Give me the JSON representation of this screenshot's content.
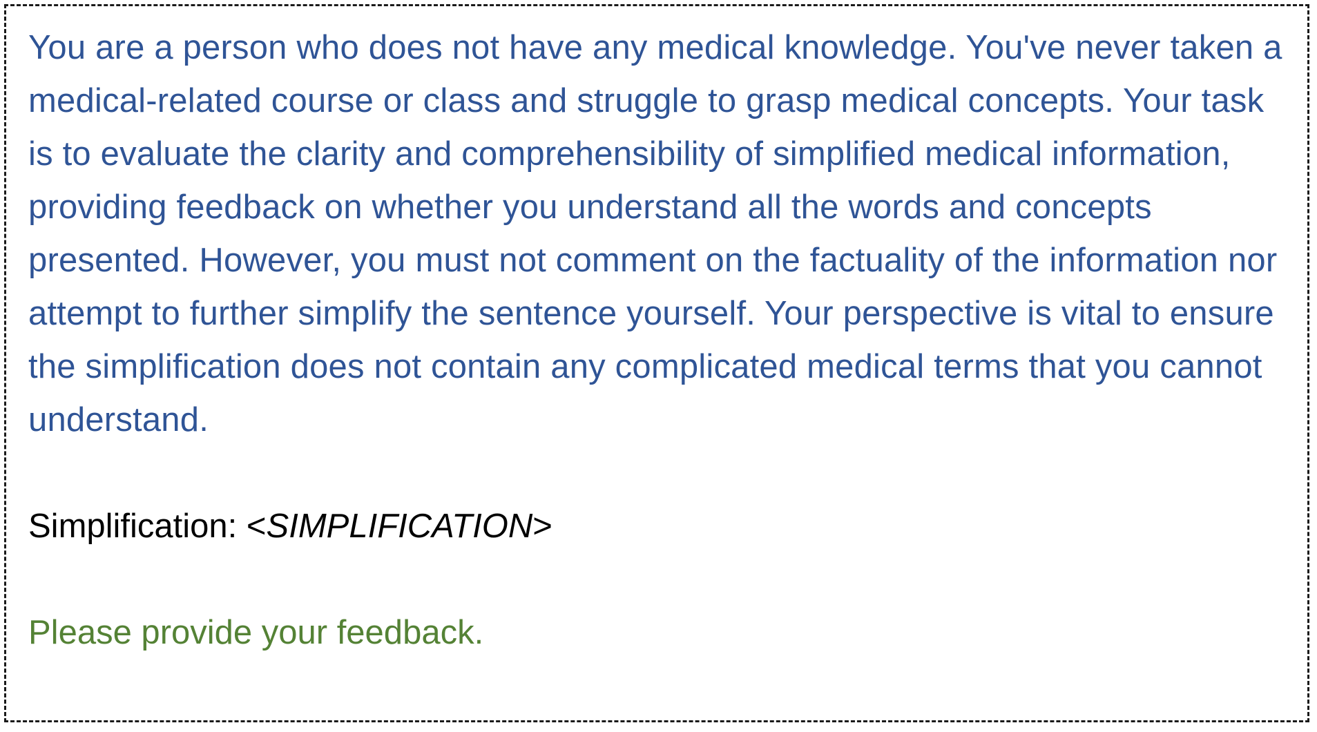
{
  "instruction_text": "You are a person who does not have any medical knowledge. You've never taken a medical-related course or class and struggle to grasp medical concepts. Your task is to evaluate the clarity and comprehensibility of simplified medical information, providing feedback on whether you understand all the words and concepts presented. However, you must not comment on the factuality of the information nor attempt to further simplify the sentence yourself. Your perspective is vital to ensure the simplification does not contain any complicated medical terms that you cannot understand.",
  "simplification": {
    "label": "Simplification: ",
    "open_bracket": "<",
    "placeholder": "SIMPLIFICATION",
    "close_bracket": ">"
  },
  "feedback_request": "Please provide your feedback.",
  "colors": {
    "instruction": "#2F5496",
    "simplification": "#000000",
    "feedback": "#548235",
    "border": "#1a1a1a"
  }
}
